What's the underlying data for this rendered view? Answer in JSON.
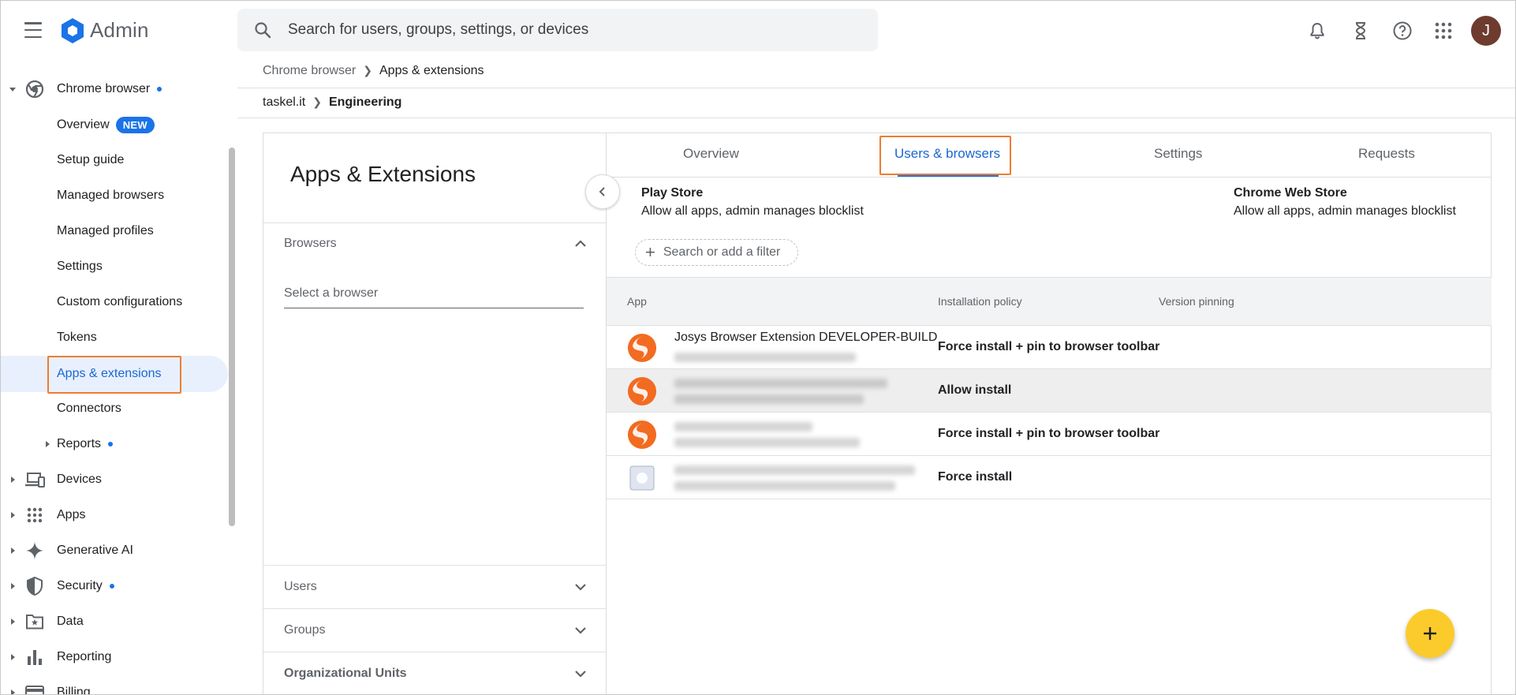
{
  "header": {
    "app_name": "Admin",
    "search_placeholder": "Search for users, groups, settings, or devices",
    "avatar_initial": "J"
  },
  "sidebar": {
    "chrome_browser": "Chrome browser",
    "sub_items": [
      {
        "label": "Overview",
        "badge": "NEW"
      },
      {
        "label": "Setup guide"
      },
      {
        "label": "Managed browsers"
      },
      {
        "label": "Managed profiles"
      },
      {
        "label": "Settings"
      },
      {
        "label": "Custom configurations"
      },
      {
        "label": "Tokens"
      },
      {
        "label": "Apps & extensions",
        "active": true
      },
      {
        "label": "Connectors"
      },
      {
        "label": "Reports"
      }
    ],
    "top_items": [
      {
        "label": "Devices",
        "icon": "devices-icon"
      },
      {
        "label": "Apps",
        "icon": "apps-grid-icon"
      },
      {
        "label": "Generative AI",
        "icon": "sparkle-icon"
      },
      {
        "label": "Security",
        "icon": "shield-icon"
      },
      {
        "label": "Data",
        "icon": "folder-star-icon"
      },
      {
        "label": "Reporting",
        "icon": "bar-chart-icon"
      },
      {
        "label": "Billing",
        "icon": "credit-card-icon"
      }
    ]
  },
  "breadcrumbs": {
    "level1": [
      "Chrome browser",
      "Apps & extensions"
    ],
    "level2": [
      "taskel.it",
      "Engineering"
    ]
  },
  "left_panel": {
    "title": "Apps & Extensions",
    "browsers": "Browsers",
    "select_placeholder": "Select a browser",
    "users": "Users",
    "groups": "Groups",
    "org_units": "Organizational Units"
  },
  "tabs": [
    "Overview",
    "Users & browsers",
    "Settings",
    "Requests"
  ],
  "active_tab": "Users & browsers",
  "stores": {
    "play_store": {
      "title": "Play Store",
      "desc": "Allow all apps, admin manages blocklist"
    },
    "chrome_web_store": {
      "title": "Chrome Web Store",
      "desc": "Allow all apps, admin manages blocklist"
    }
  },
  "filter_placeholder": "Search or add a filter",
  "table": {
    "columns": [
      "App",
      "Installation policy",
      "Version pinning"
    ],
    "rows": [
      {
        "app": "Josys Browser Extension DEVELOPER-BUILD",
        "policy": "Force install + pin to browser toolbar"
      },
      {
        "app": "",
        "policy": "Allow install"
      },
      {
        "app": "",
        "policy": "Force install + pin to browser toolbar"
      },
      {
        "app": "",
        "policy": "Force install"
      }
    ]
  },
  "colors": {
    "accent": "#1a73e8",
    "highlight_box": "#ed7d31",
    "fab": "#fbcb2c",
    "app_orange": "#f26b21"
  }
}
